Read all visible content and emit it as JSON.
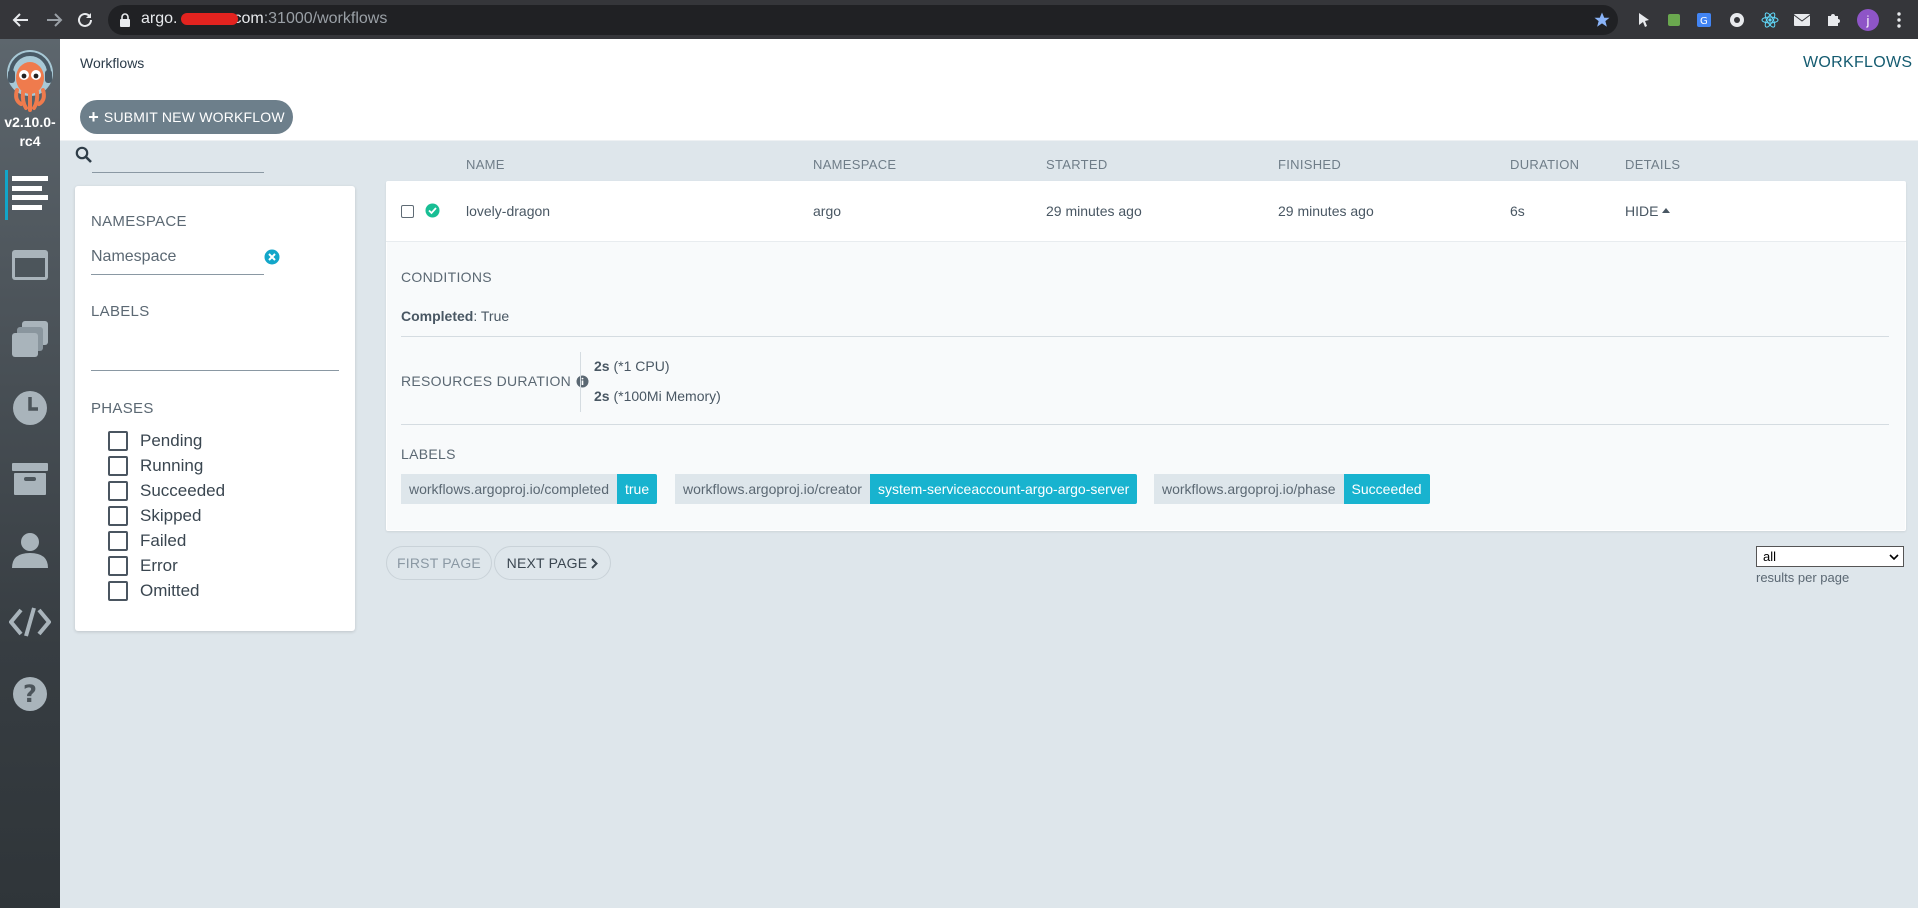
{
  "browser": {
    "url_host_visible": "argo.",
    "url_host_suffix": "com",
    "url_port_path": ":31000/workflows",
    "profile_initial": "j"
  },
  "sidebar": {
    "version": "v2.10.0-rc4",
    "items": [
      {
        "icon": "workflows-icon"
      },
      {
        "icon": "workflow-templates-icon"
      },
      {
        "icon": "cluster-templates-icon"
      },
      {
        "icon": "cron-workflows-icon"
      },
      {
        "icon": "archived-workflows-icon"
      },
      {
        "icon": "user-icon"
      },
      {
        "icon": "api-docs-icon"
      },
      {
        "icon": "help-icon"
      }
    ]
  },
  "header": {
    "title": "Workflows",
    "title_right": "WORKFLOWS",
    "submit_label": "SUBMIT NEW WORKFLOW"
  },
  "filters": {
    "namespace_heading": "NAMESPACE",
    "namespace_placeholder": "Namespace",
    "labels_heading": "LABELS",
    "phases_heading": "PHASES",
    "phases": [
      "Pending",
      "Running",
      "Succeeded",
      "Skipped",
      "Failed",
      "Error",
      "Omitted"
    ]
  },
  "table": {
    "columns": {
      "name": "NAME",
      "namespace": "NAMESPACE",
      "started": "STARTED",
      "finished": "FINISHED",
      "duration": "DURATION",
      "details": "DETAILS"
    },
    "rows": [
      {
        "name": "lovely-dragon",
        "namespace": "argo",
        "started": "29 minutes ago",
        "finished": "29 minutes ago",
        "duration": "6s",
        "details": "HIDE",
        "status": "succeeded"
      }
    ]
  },
  "details": {
    "conditions_heading": "CONDITIONS",
    "condition_key": "Completed",
    "condition_value": ": True",
    "resources_heading": "RESOURCES DURATION",
    "resources": [
      {
        "value": "2s",
        "unit": " (*1 CPU)"
      },
      {
        "value": "2s",
        "unit": " (*100Mi Memory)"
      }
    ],
    "labels_heading": "LABELS",
    "labels": [
      {
        "key": "workflows.argoproj.io/completed",
        "value": "true"
      },
      {
        "key": "workflows.argoproj.io/creator",
        "value": "system-serviceaccount-argo-argo-server"
      },
      {
        "key": "workflows.argoproj.io/phase",
        "value": "Succeeded"
      }
    ]
  },
  "pagination": {
    "first_label": "FIRST PAGE",
    "next_label": "NEXT PAGE",
    "per_page_value": "all",
    "per_page_label": "results per page"
  },
  "colors": {
    "accent": "#18b3cf",
    "success": "#18be94",
    "sidebar": "#3f464b",
    "background": "#dee6eb"
  }
}
